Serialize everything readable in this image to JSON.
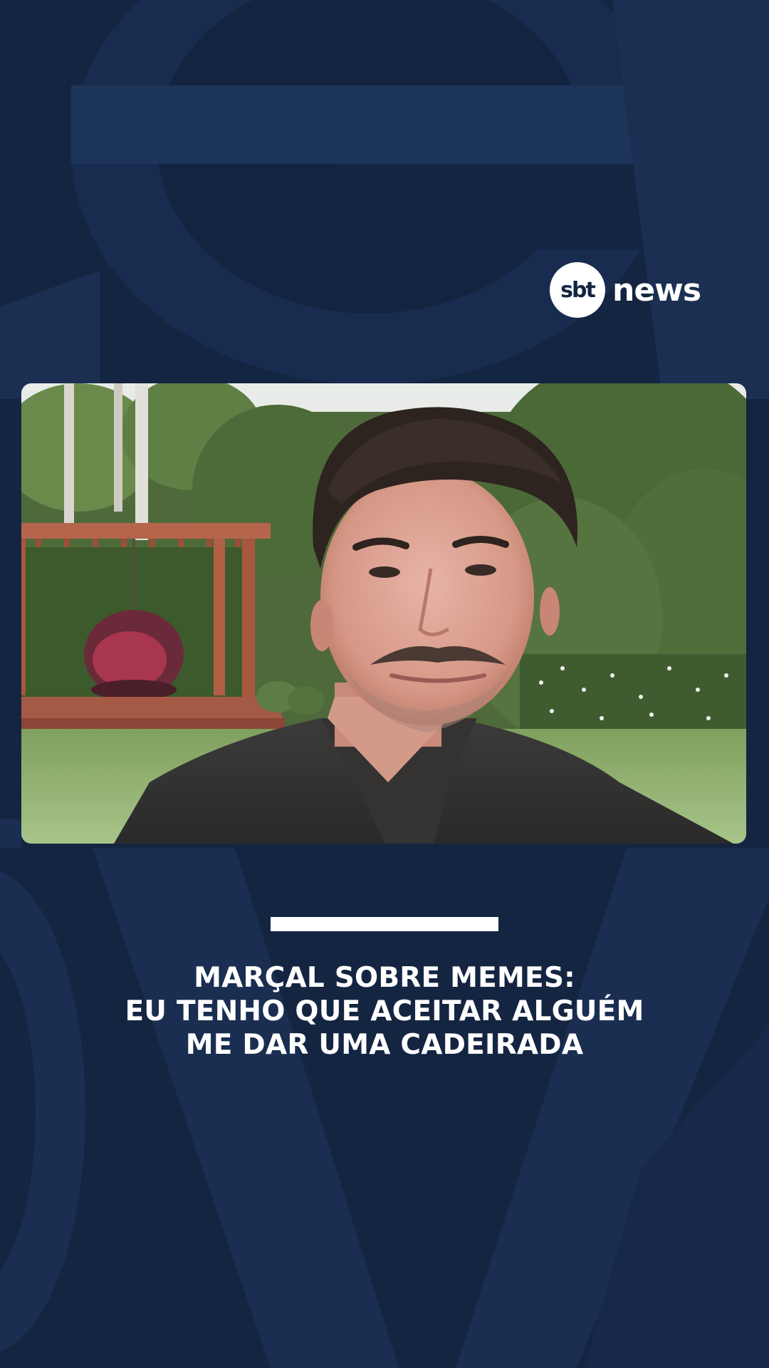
{
  "brand": {
    "badge_text": "sbt",
    "word_text": "news",
    "badge_color": "#ffffff",
    "background_color": "#142542",
    "accent_color": "#ffffff"
  },
  "video": {
    "scene": "interview-webcam-garden"
  },
  "headline": {
    "line1": "MARÇAL SOBRE MEMES:",
    "line2": "EU TENHO QUE ACEITAR ALGUÉM",
    "line3": "ME DAR UMA CADEIRADA"
  }
}
